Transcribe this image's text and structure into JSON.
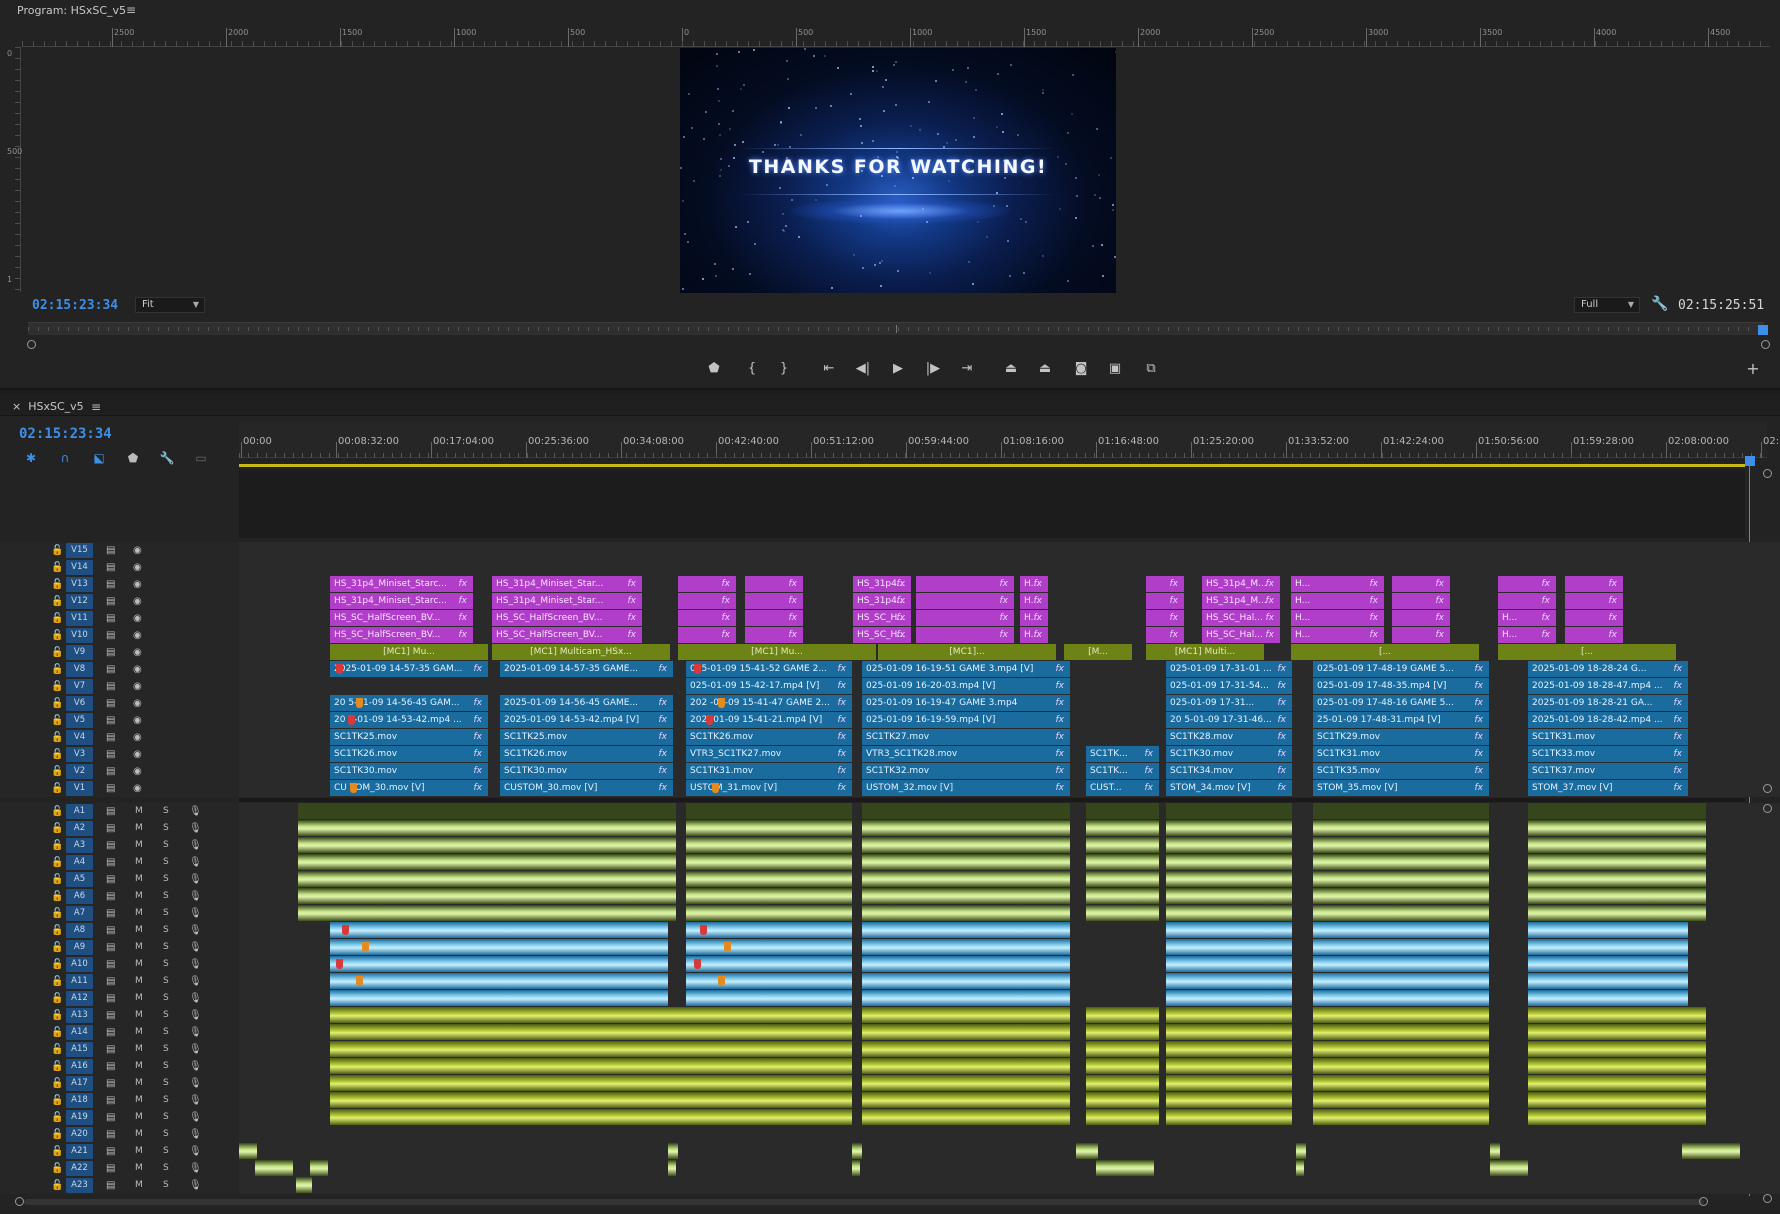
{
  "program": {
    "title": "Program: HSxSC_v5",
    "ruler_labels": [
      "2500",
      "2000",
      "1500",
      "1000",
      "500",
      "0",
      "500",
      "1000",
      "1500",
      "2000",
      "2500",
      "3000",
      "3500",
      "4000",
      "4500"
    ],
    "vruler_labels": [
      "0",
      "500",
      "1"
    ],
    "video_text": "THANKS FOR WATCHING!",
    "timecode_left": "02:15:23:34",
    "zoom": "Fit",
    "resolution": "Full",
    "timecode_right": "02:15:25:51"
  },
  "transport": [
    "marker",
    "mark-in",
    "mark-out",
    "go-to-in",
    "step-back",
    "play",
    "step-forward",
    "go-to-out",
    "lift",
    "extract",
    "export-frame",
    "compare",
    "multicam"
  ],
  "sequence": {
    "tab": "HSxSC_v5",
    "timecode": "02:15:23:34",
    "ruler": [
      "00:00",
      "00:08:32:00",
      "00:17:04:00",
      "00:25:36:00",
      "00:34:08:00",
      "00:42:40:00",
      "00:51:12:00",
      "00:59:44:00",
      "01:08:16:00",
      "01:16:48:00",
      "01:25:20:00",
      "01:33:52:00",
      "01:42:24:00",
      "01:50:56:00",
      "01:59:28:00",
      "02:08:00:00",
      "02:16"
    ],
    "video_tracks": [
      "V15",
      "V14",
      "V13",
      "V12",
      "V11",
      "V10",
      "V9",
      "V8",
      "V7",
      "V6",
      "V5",
      "V4",
      "V3",
      "V2",
      "V1"
    ],
    "audio_tracks": [
      "A1",
      "A2",
      "A3",
      "A4",
      "A5",
      "A6",
      "A7",
      "A8",
      "A9",
      "A10",
      "A11",
      "A12",
      "A13",
      "A14",
      "A15",
      "A16",
      "A17",
      "A18",
      "A19",
      "A20",
      "A21",
      "A22",
      "A23"
    ],
    "mute": "M",
    "solo": "S",
    "clips": {
      "V13": [
        "HS_31p4_Miniset_Starc...",
        "HS_31p4_Miniset_Star...",
        "",
        "",
        "HS_31p4...",
        "",
        "H...",
        "",
        "HS_31p4_M...",
        "H...",
        "",
        ""
      ],
      "V12": [
        "HS_31p4_Miniset_Starc...",
        "HS_31p4_Miniset_Star...",
        "",
        "",
        "HS_31p4...",
        "",
        "H...",
        "",
        "HS_31p4_M...",
        "H...",
        "",
        ""
      ],
      "V11": [
        "HS_SC_HalfScreen_BV...",
        "HS_SC_HalfScreen_BV...",
        "",
        "",
        "HS_SC_H...",
        "",
        "H...",
        "",
        "HS_SC_Hal...",
        "H...",
        "",
        "H..."
      ],
      "V10": [
        "HS_SC_HalfScreen_BV...",
        "HS_SC_HalfScreen_BV...",
        "",
        "",
        "HS_SC_H...",
        "",
        "H...",
        "",
        "HS_SC_Hal...",
        "H...",
        "",
        "H..."
      ],
      "V9": [
        "[MC1] Mu...",
        "[MC1] Multicam_HSx...",
        "[MC1] Mu...",
        "[MC1]...",
        "[M...",
        "[MC1] Multi...",
        "[...",
        "[..."
      ],
      "V8": [
        "2025-01-09 14-57-35 GAM...",
        "2025-01-09 14-57-35 GAME...",
        "025-01-09 15-41-52 GAME 2...",
        "025-01-09 16-19-51 GAME 3.mp4 [V]",
        "025-01-09 17-31-01 ...",
        "025-01-09 17-48-19 GAME 5...",
        "2025-01-09 18-28-24 G..."
      ],
      "V7": [
        "025-01-09 15-42-17.mp4 [V]",
        "025-01-09 16-20-03.mp4 [V]",
        "025-01-09 17-31-54...",
        "025-01-09 17-48-35.mp4 [V]",
        "2025-01-09 18-28-47.mp4 ..."
      ],
      "V6": [
        "20 5-01-09 14-56-45 GAM...",
        "2025-01-09 14-56-45 GAME...",
        "202 -01-09 15-41-47 GAME 2...",
        "025-01-09 16-19-47 GAME 3.mp4",
        "025-01-09 17-31...",
        "025-01-09 17-48-16 GAME 5...",
        "2025-01-09 18-28-21 GA..."
      ],
      "V5": [
        "20 5-01-09 14-53-42.mp4 ...",
        "2025-01-09 14-53-42.mp4 [V]",
        "202 -01-09 15-41-21.mp4 [V]",
        "025-01-09 16-19-59.mp4 [V]",
        "20 5-01-09 17-31-46...",
        "25-01-09 17-48-31.mp4 [V]",
        "2025-01-09 18-28-42.mp4 ..."
      ],
      "V4": [
        "SC1TK25.mov",
        "SC1TK25.mov",
        "SC1TK26.mov",
        "SC1TK27.mov",
        "SC1TK28.mov",
        "SC1TK29.mov",
        "SC1TK31.mov"
      ],
      "V3": [
        "SC1TK26.mov",
        "SC1TK26.mov",
        "VTR3_SC1TK27.mov",
        "VTR3_SC1TK28.mov",
        "SC1TK...",
        "SC1TK30.mov",
        "SC1TK31.mov",
        "SC1TK33.mov"
      ],
      "V2": [
        "SC1TK30.mov",
        "SC1TK30.mov",
        "SC1TK31.mov",
        "SC1TK32.mov",
        "SC1TK...",
        "SC1TK34.mov",
        "SC1TK35.mov",
        "SC1TK37.mov"
      ],
      "V1": [
        "CU TOM_30.mov [V]",
        "CUSTOM_30.mov [V]",
        "USTOM_31.mov [V]",
        "USTOM_32.mov [V]",
        "CUST...",
        "STOM_34.mov [V]",
        "STOM_35.mov [V]",
        "STOM_37.mov [V]"
      ]
    }
  },
  "colors": {
    "accent": "#3d8fe8",
    "video_pink": "#b13ec8",
    "video_olive": "#6e8315",
    "video_blue": "#1a6c9f",
    "audio_green": "#c7e58a",
    "audio_yellow": "#c3d63e"
  }
}
